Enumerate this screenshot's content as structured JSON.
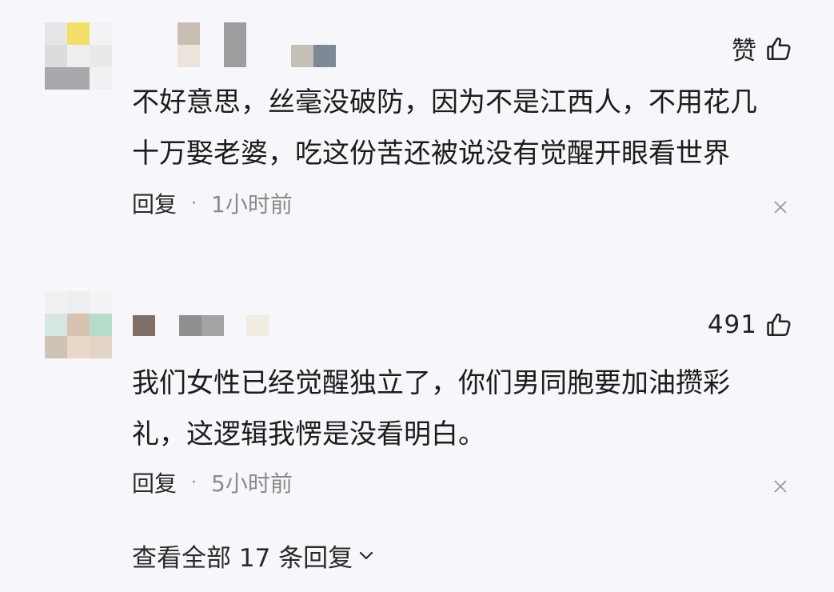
{
  "comments": [
    {
      "like_label": "赞",
      "text_line1": "不好意思，丝毫没破防，因为不是江西人，不用花几",
      "text_line2": "十万娶老婆，吃这份苦还被说没有觉醒开眼看世界",
      "reply_label": "回复",
      "separator": "·",
      "time": "1小时前"
    },
    {
      "like_label": "491",
      "text_line1": "我们女性已经觉醒独立了，你们男同胞要加油攒彩",
      "text_line2": "礼，这逻辑我愣是没看明白。",
      "reply_label": "回复",
      "separator": "·",
      "time": "5小时前"
    }
  ],
  "view_all_label": "查看全部 17 条回复",
  "icons": {
    "like": "thumbs-up-icon",
    "dismiss": "close-icon",
    "expand": "chevron-down-icon"
  },
  "colors": {
    "background": "#f7f7fb",
    "text": "#1c1c1c",
    "muted": "#8a8a8a"
  }
}
